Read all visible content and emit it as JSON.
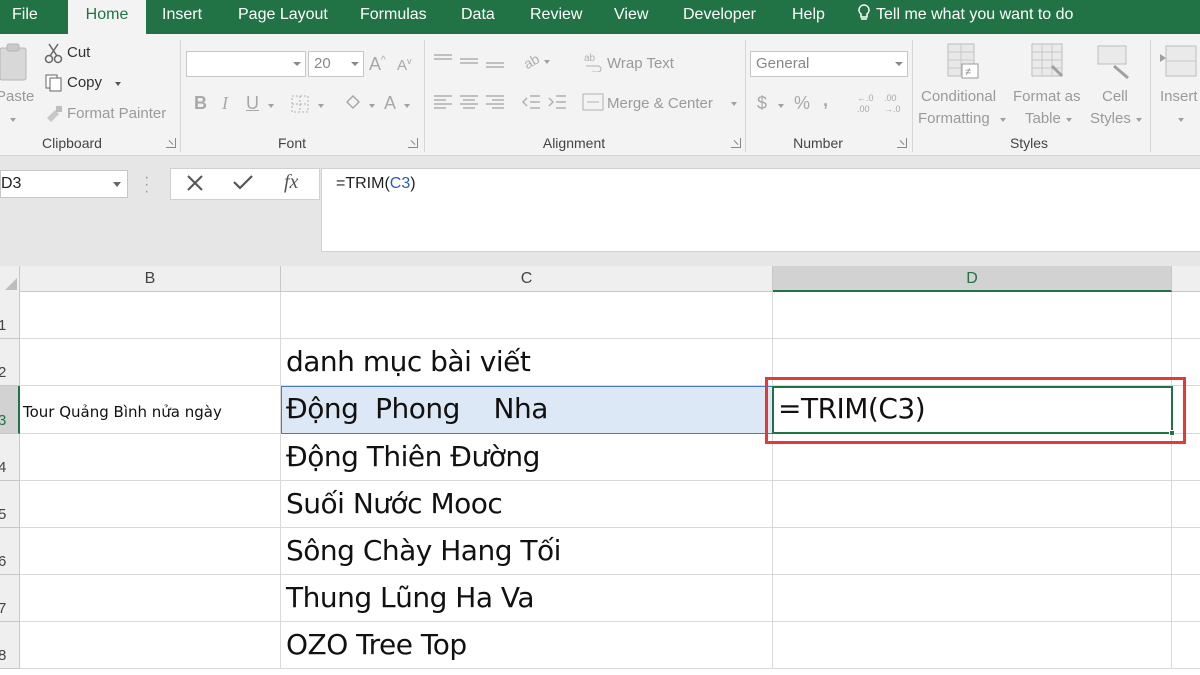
{
  "menu": {
    "tabs": [
      "File",
      "Home",
      "Insert",
      "Page Layout",
      "Formulas",
      "Data",
      "Review",
      "View",
      "Developer",
      "Help"
    ],
    "tell_me": "Tell me what you want to do",
    "active_tab": "Home"
  },
  "ribbon": {
    "clipboard": {
      "paste": "Paste",
      "cut": "Cut",
      "copy": "Copy",
      "format_painter": "Format Painter",
      "label": "Clipboard"
    },
    "font": {
      "font_name": "",
      "font_size": "20",
      "bold": "B",
      "italic": "I",
      "underline": "U",
      "label": "Font"
    },
    "alignment": {
      "wrap_text": "Wrap Text",
      "merge_center": "Merge & Center",
      "label": "Alignment"
    },
    "number": {
      "format": "General",
      "currency": "$",
      "percent": "%",
      "comma": ",",
      "label": "Number"
    },
    "styles": {
      "conditional_1": "Conditional",
      "conditional_2": "Formatting",
      "format_as_1": "Format as",
      "format_as_2": "Table",
      "cell_styles_1": "Cell",
      "cell_styles_2": "Styles",
      "label": "Styles"
    },
    "cells": {
      "insert": "Insert"
    }
  },
  "formula_bar": {
    "name_box": "D3",
    "fx": "fx",
    "formula_prefix": "=TRIM(",
    "formula_ref": "C3",
    "formula_suffix": ")"
  },
  "sheet": {
    "columns": [
      "B",
      "C",
      "D"
    ],
    "selected_column": "D",
    "rows": [
      "1",
      "2",
      "3",
      "4",
      "5",
      "6",
      "7",
      "8"
    ],
    "selected_row": "3",
    "b3": "Tour Quảng Bình nửa ngày",
    "c_values": [
      "",
      "danh mục bài viết",
      "Động  Phong    Nha",
      "Động Thiên Đường",
      "Suối Nước Mooc",
      "Sông Chày Hang Tối",
      "Thung Lũng Ha Va",
      "OZO Tree Top"
    ],
    "d3": "=TRIM(C3)"
  },
  "colors": {
    "excel_green": "#217346",
    "highlight_red": "#e53935",
    "selection_blue": "#dce8f6"
  }
}
